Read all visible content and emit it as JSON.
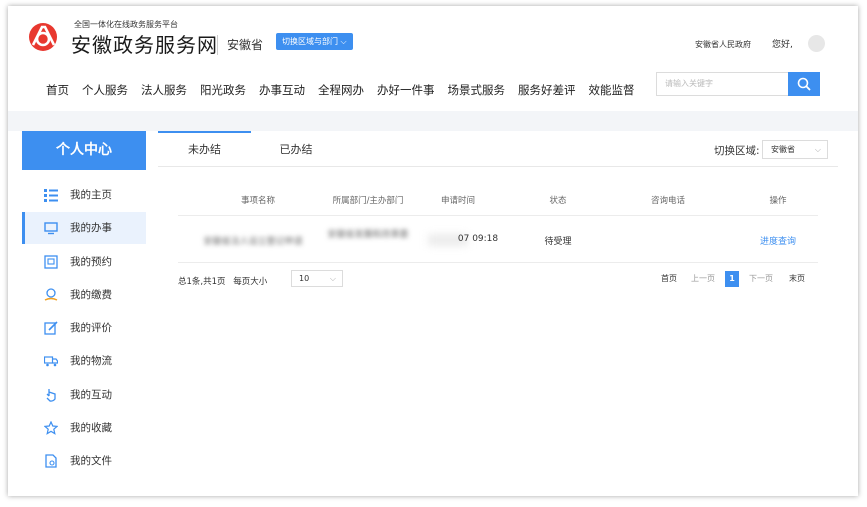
{
  "header": {
    "platform_small": "全国一体化在线政务服务平台",
    "platform_big": "安徽政务服务网",
    "province": "安徽省",
    "switch_label": "切换区域与部门",
    "gov_name": "安徽省人民政府",
    "greeting": "您好,",
    "colors": {
      "accent": "#3d8ff0",
      "logo_red": "#e8382f"
    }
  },
  "nav": {
    "items": [
      "首页",
      "个人服务",
      "法人服务",
      "阳光政务",
      "办事互动",
      "全程网办",
      "办好一件事",
      "场景式服务",
      "服务好差评",
      "效能监督"
    ],
    "search_placeholder": "请输入关键字"
  },
  "sidebar": {
    "title": "个人中心",
    "items": [
      {
        "label": "我的主页",
        "icon": "list-icon"
      },
      {
        "label": "我的办事",
        "icon": "monitor-icon"
      },
      {
        "label": "我的预约",
        "icon": "calendar-icon"
      },
      {
        "label": "我的缴费",
        "icon": "money-icon"
      },
      {
        "label": "我的评价",
        "icon": "edit-icon"
      },
      {
        "label": "我的物流",
        "icon": "truck-icon"
      },
      {
        "label": "我的互动",
        "icon": "hand-icon"
      },
      {
        "label": "我的收藏",
        "icon": "star-icon"
      },
      {
        "label": "我的文件",
        "icon": "file-icon"
      }
    ]
  },
  "tabs": [
    "未办结",
    "已办结"
  ],
  "region": {
    "label": "切换区域:",
    "value": "安徽省"
  },
  "table": {
    "headers": [
      "事项名称",
      "所属部门/主办部门",
      "申请时间",
      "状态",
      "咨询电话",
      "操作"
    ],
    "rows": [
      {
        "name": "安徽省法人设立登记申请",
        "dept": "安徽省发展和改革委",
        "time": "07 09:18",
        "status": "待受理",
        "phone": "",
        "action": "进度查询"
      }
    ]
  },
  "pager": {
    "summary": "总1条,共1页",
    "page_size_label": "每页大小",
    "page_size": "10",
    "first": "首页",
    "prev": "上一页",
    "current": "1",
    "next": "下一页",
    "last": "末页"
  }
}
